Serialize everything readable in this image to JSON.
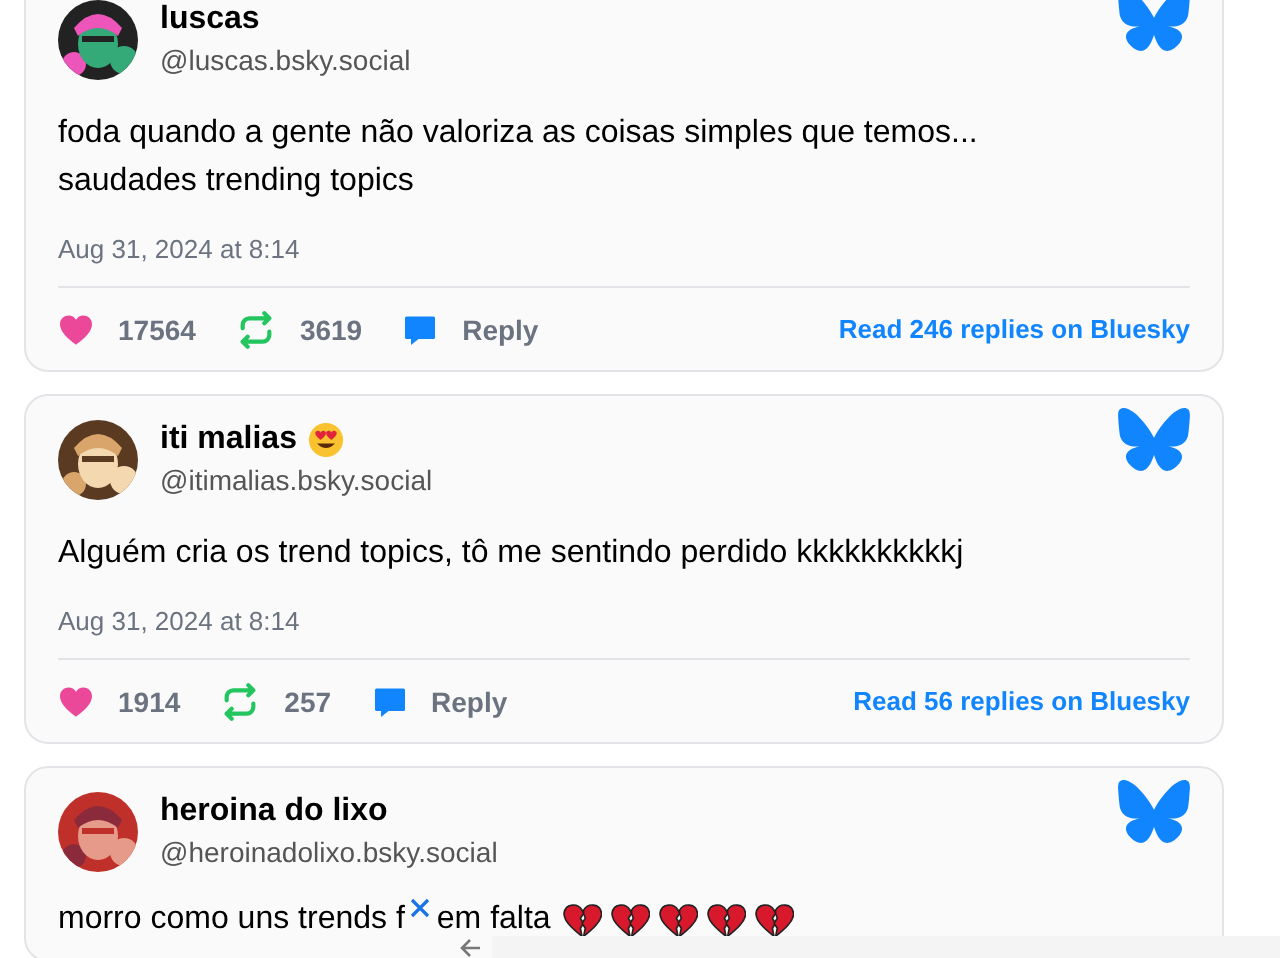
{
  "posts": [
    {
      "name": "luscas",
      "handle": "@luscas.bsky.social",
      "text": [
        "foda quando a gente não valoriza as coisas simples que temos...",
        "saudades trending topics"
      ],
      "date": "Aug 31, 2024 at 8:14",
      "likes": "17564",
      "reposts": "3619",
      "reply": "Reply",
      "read_replies": "Read 246 replies on Bluesky"
    },
    {
      "name": "iti malias",
      "handle": "@itimalias.bsky.social",
      "text": [
        "Alguém cria os trend topics, tô me sentindo perdido kkkkkkkkkkj"
      ],
      "date": "Aug 31, 2024 at 8:14",
      "likes": "1914",
      "reposts": "257",
      "reply": "Reply",
      "read_replies": "Read 56 replies on Bluesky"
    },
    {
      "name": "heroina do lixo",
      "handle": "@heroinadolixo.bsky.social",
      "text_before_overlay": "morro como uns trends f",
      "text_after_overlay": "em falta"
    }
  ]
}
